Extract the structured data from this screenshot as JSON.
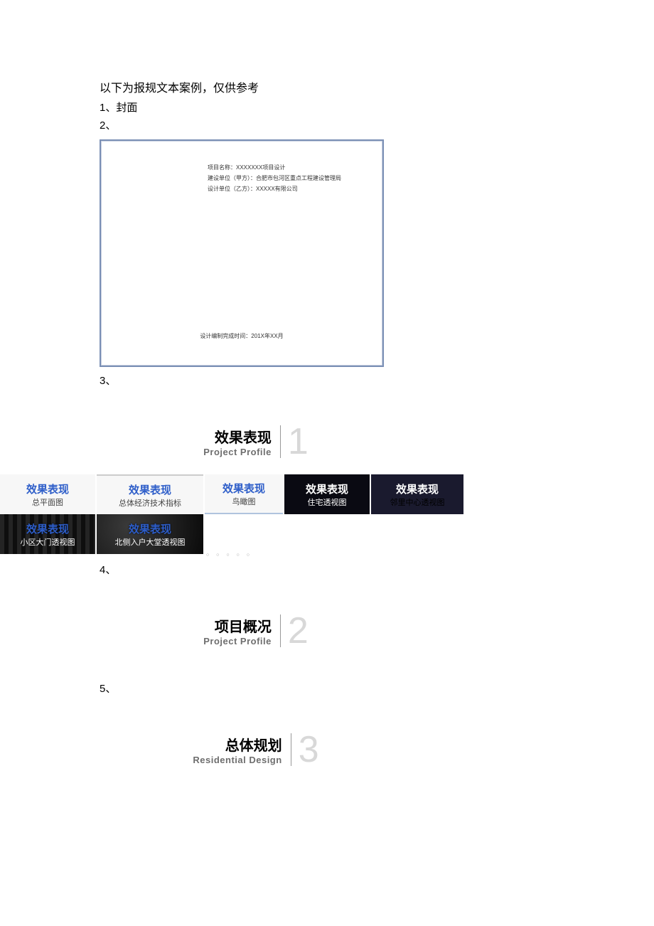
{
  "intro": "以下为报规文本案例，仅供参考",
  "items": {
    "n1": "1、封面",
    "n2": "2、",
    "n3": "3、",
    "n4": "4、",
    "n5": "5、"
  },
  "cover": {
    "line1": "项目名称：XXXXXXX项目设计",
    "line2": "建设单位（甲方）：合肥市包河区重点工程建设管理局",
    "line3": "设计单位（乙方）：XXXXX有限公司",
    "date": "设计编制完成时间：201X年XX月"
  },
  "sections": {
    "s1": {
      "cn": "效果表现",
      "en": "Project Profile",
      "num": "1"
    },
    "s2": {
      "cn": "项目概况",
      "en": "Project Profile",
      "num": "2"
    },
    "s3": {
      "cn": "总体规划",
      "en": "Residential Design",
      "num": "3"
    }
  },
  "tiles": {
    "r1": [
      {
        "main": "效果表现",
        "sub": "总平面图"
      },
      {
        "main": "效果表现",
        "sub": "总体经济技术指标"
      },
      {
        "main": "效果表现",
        "sub": "鸟瞰图"
      },
      {
        "main": "效果表现",
        "sub": "住宅透视图"
      },
      {
        "main": "效果表现",
        "sub": "邻里中心透视图"
      }
    ],
    "r2": [
      {
        "main": "效果表现",
        "sub": "小区大门透视图"
      },
      {
        "main": "效果表现",
        "sub": "北侧入户大堂透视图"
      }
    ]
  },
  "dots": "○ ○ ○ ○ ○"
}
